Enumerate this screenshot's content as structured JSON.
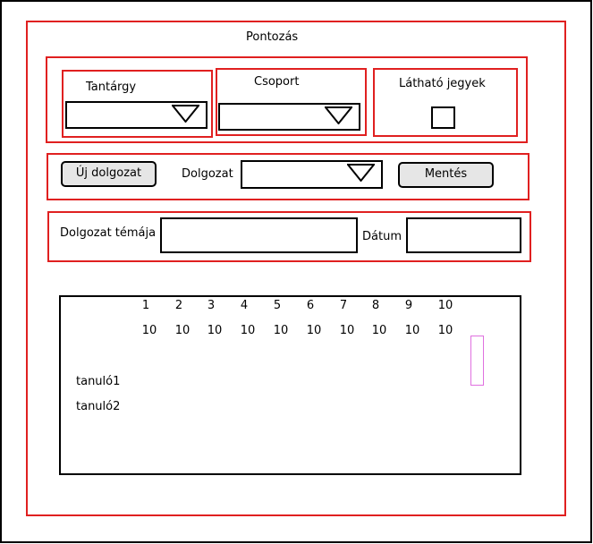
{
  "title": "Pontozás",
  "filters": {
    "subject_label": "Tantárgy",
    "group_label": "Csoport",
    "visible_grades_label": "Látható jegyek"
  },
  "toolbar": {
    "new_test_label": "Új dolgozat",
    "test_label": "Dolgozat",
    "save_label": "Mentés"
  },
  "details": {
    "topic_label": "Dolgozat témája",
    "date_label": "Dátum"
  },
  "grid": {
    "task_numbers": [
      "1",
      "2",
      "3",
      "4",
      "5",
      "6",
      "7",
      "8",
      "9",
      "10"
    ],
    "max_points": [
      "10",
      "10",
      "10",
      "10",
      "10",
      "10",
      "10",
      "10",
      "10",
      "10"
    ],
    "students": [
      "tanuló1",
      "tanuló2"
    ]
  },
  "colors": {
    "section_border": "#e02020",
    "scroll_marker": "#e070e0"
  }
}
